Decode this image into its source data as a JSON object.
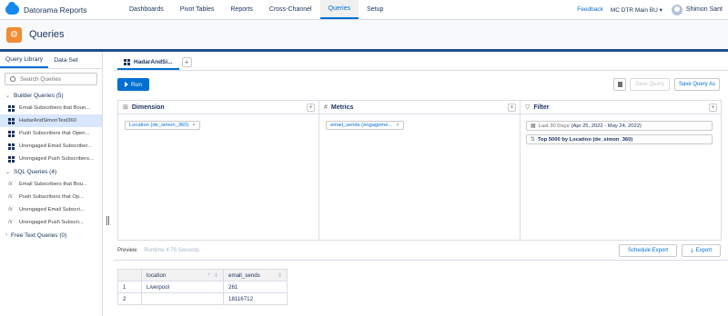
{
  "topnav": {
    "app_name": "Datorama Reports",
    "tabs": [
      {
        "label": "Dashboards"
      },
      {
        "label": "Pivot Tables"
      },
      {
        "label": "Reports"
      },
      {
        "label": "Cross-Channel"
      },
      {
        "label": "Queries",
        "active": true
      },
      {
        "label": "Setup"
      }
    ],
    "feedback": "Feedback",
    "business_unit": "MC DTR Main BU",
    "user_name": "Shimon Sant"
  },
  "page": {
    "title": "Queries"
  },
  "left": {
    "tabs": [
      {
        "label": "Query Library",
        "active": true
      },
      {
        "label": "Data Set"
      }
    ],
    "search_placeholder": "Search Queries",
    "builder_group": "Builder Queries (5)",
    "builder_items": [
      {
        "label": "Email Subscribers that Boun...",
        "selected": false
      },
      {
        "label": "HadarAndSimonTest360",
        "selected": true
      },
      {
        "label": "Push Subscribers that Open...",
        "selected": false
      },
      {
        "label": "Unengaged Email Subscriber...",
        "selected": false
      },
      {
        "label": "Unengaged Push Subscribers...",
        "selected": false
      }
    ],
    "sql_group": "SQL Queries (4)",
    "sql_items": [
      {
        "label": "Email Subscribers that Bou..."
      },
      {
        "label": "Push Subscribers that Op..."
      },
      {
        "label": "Unengaged Email Subscri..."
      },
      {
        "label": "Unengaged Push Subscri..."
      }
    ],
    "freetext_group": "Free Text Queries (0)"
  },
  "main": {
    "query_tab": "HadarAndSi...",
    "run_label": "Run",
    "save_label": "Save Query",
    "save_as_label": "Save Query As",
    "dimension": {
      "title": "Dimension",
      "pill": "Location (de_simon_360)"
    },
    "metrics": {
      "title": "Metrics",
      "pill": "email_sends (engageme..."
    },
    "filter": {
      "title": "Filter",
      "date_muted": "Last 30 Days",
      "date_range": "(Apr 25, 2022 - May 24, 2022)",
      "top": "Top 5000 by Location (de_simon_360)"
    },
    "preview_label": "Preview",
    "runtime": "Runtime 4.76 Seconds",
    "schedule_label": "Schedule Export",
    "export_label": "Export"
  },
  "results": {
    "columns": [
      "location",
      "email_sends"
    ],
    "rows": [
      {
        "n": "1",
        "location": "Liverpool",
        "email_sends": "261"
      },
      {
        "n": "2",
        "location": "",
        "email_sends": "18116712"
      }
    ]
  }
}
